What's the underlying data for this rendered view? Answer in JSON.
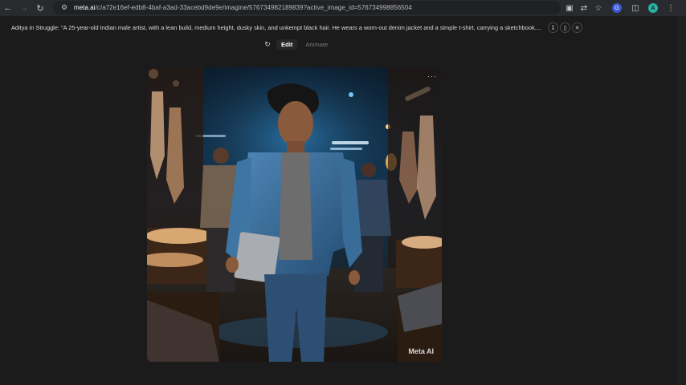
{
  "browser": {
    "url_host": "meta.ai",
    "url_path": "/c/a72e16ef-edb8-4baf-a3ad-33acebd9de9e/imagine/576734982189839?active_image_id=576734998856504",
    "avatar_letter": "A",
    "extension_badge": "G"
  },
  "prompt": {
    "text": "Aditya in Struggle: \"A 25-year-old Indian male artist, with a lean build, medium height, dusky skin, and unkempt black hair. He wears a worn-out denim jacket and a simple t-shirt, carrying a sketchbook...."
  },
  "toolbar": {
    "edit_label": "Edit",
    "animate_label": "Animate"
  },
  "image": {
    "watermark": "Meta AI",
    "more_label": "···"
  },
  "colors": {
    "page_bg": "#1b1b1b",
    "chrome_bg": "#292a2d",
    "omnibox_bg": "#202124"
  }
}
